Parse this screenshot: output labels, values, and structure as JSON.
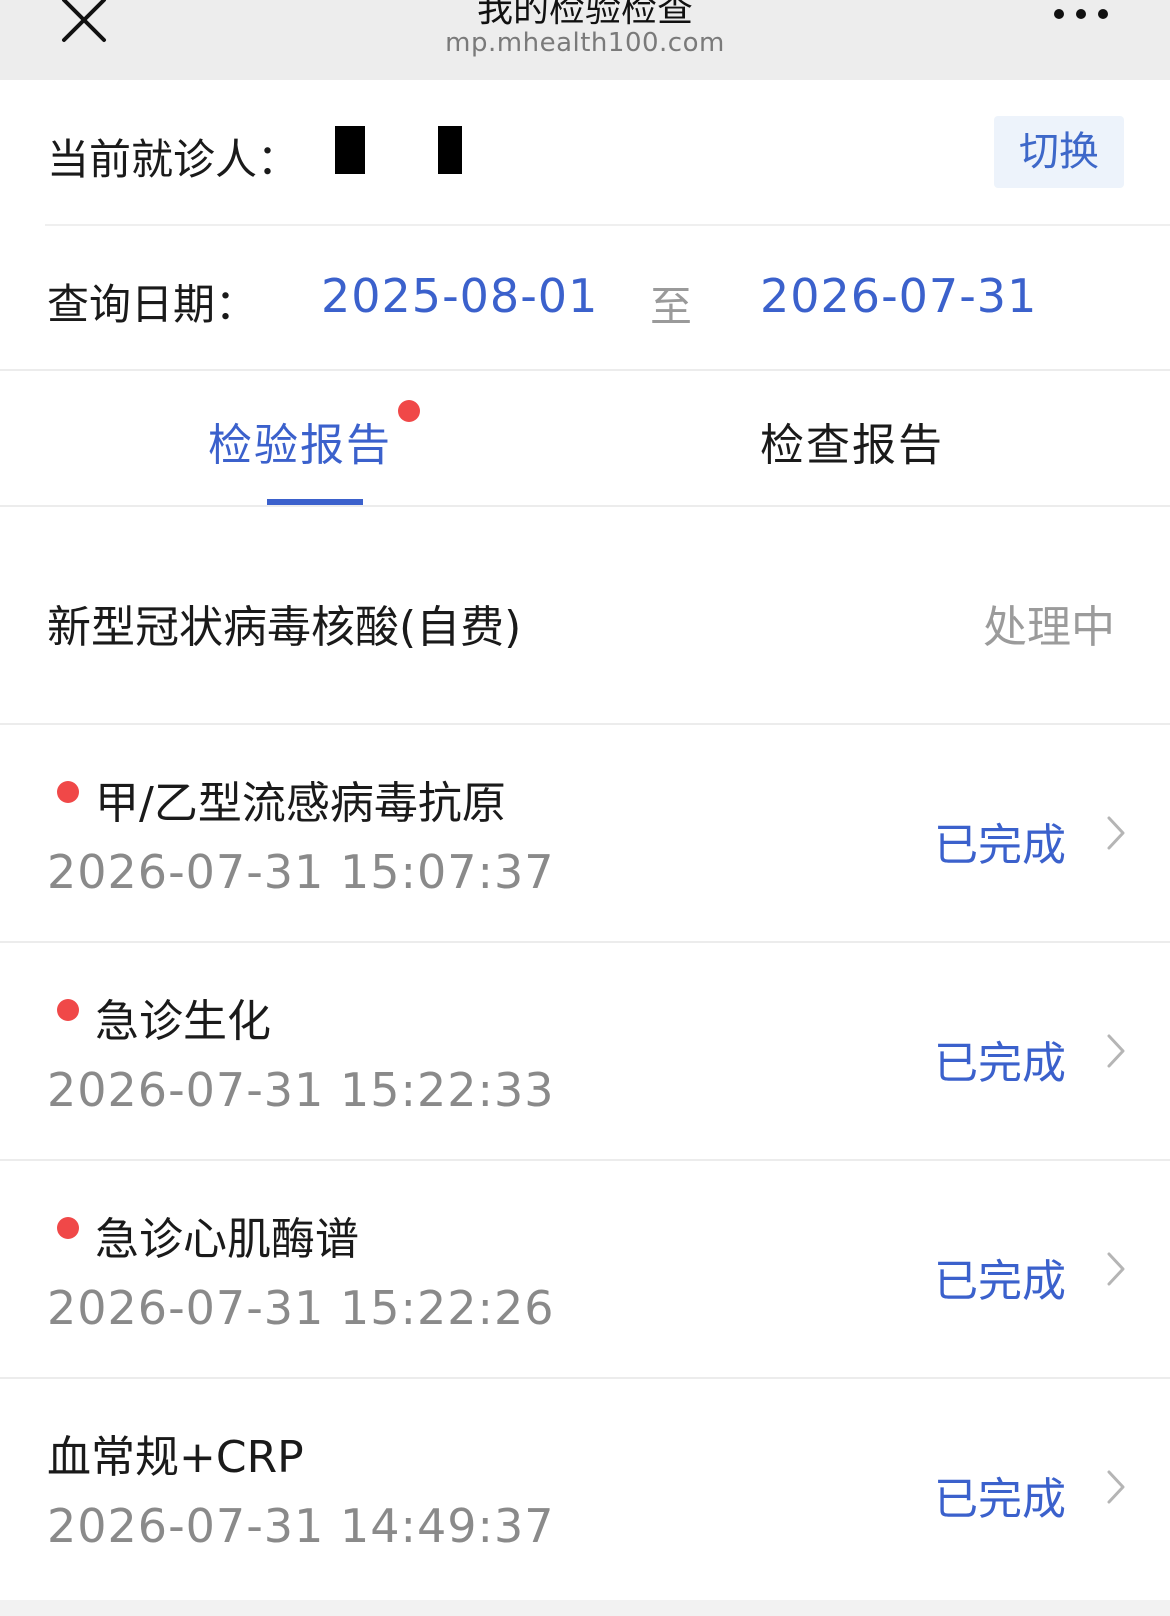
{
  "topbar": {
    "title": "我的检验检查",
    "domain": "mp.mhealth100.com",
    "close_icon": "close-icon",
    "more_icon": "more-dots-icon"
  },
  "patient": {
    "label": "当前就诊人：",
    "switch_label": "切换"
  },
  "query": {
    "label": "查询日期：",
    "start_date": "2025-08-01",
    "separator": "至",
    "end_date": "2026-07-31"
  },
  "tabs": [
    {
      "label": "检验报告",
      "active": true,
      "has_badge": true
    },
    {
      "label": "检查报告",
      "active": false,
      "has_badge": false
    }
  ],
  "reports": [
    {
      "name": "新型冠状病毒核酸(自费)",
      "time": "",
      "status": "处理中",
      "unread": false
    },
    {
      "name": "甲/乙型流感病毒抗原",
      "time": "2026-07-31 15:07:37",
      "status": "已完成",
      "unread": true
    },
    {
      "name": "急诊生化",
      "time": "2026-07-31 15:22:33",
      "status": "已完成",
      "unread": true
    },
    {
      "name": "急诊心肌酶谱",
      "time": "2026-07-31 15:22:26",
      "status": "已完成",
      "unread": true
    },
    {
      "name": "血常规+CRP",
      "time": "2026-07-31 14:49:37",
      "status": "已完成",
      "unread": false
    }
  ],
  "colors": {
    "accent": "#3b61cc",
    "unread_dot": "#f04848",
    "pending": "#9b9b9b",
    "time_text": "#8a8a8a",
    "switch_bg": "#edf3fb"
  }
}
